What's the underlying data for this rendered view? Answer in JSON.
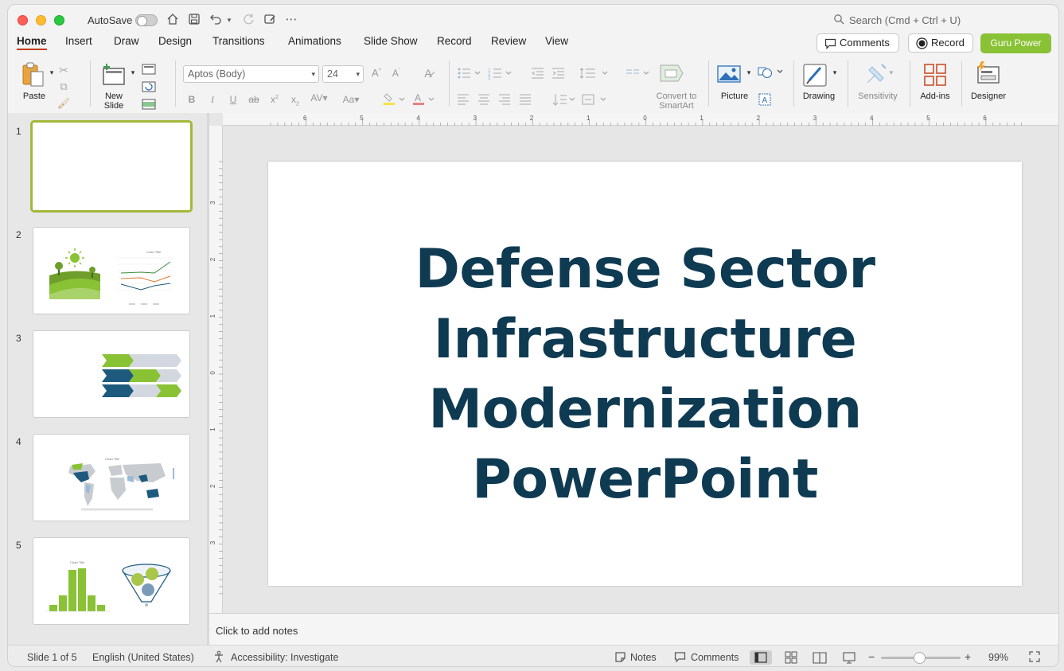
{
  "titlebar": {
    "autosave_label": "AutoSave",
    "search_placeholder": "Search (Cmd + Ctrl + U)"
  },
  "tabs": [
    {
      "label": "Home",
      "active": true
    },
    {
      "label": "Insert"
    },
    {
      "label": "Draw"
    },
    {
      "label": "Design"
    },
    {
      "label": "Transitions"
    },
    {
      "label": "Animations"
    },
    {
      "label": "Slide Show"
    },
    {
      "label": "Record"
    },
    {
      "label": "Review"
    },
    {
      "label": "View"
    }
  ],
  "header_buttons": {
    "comments": "Comments",
    "record": "Record",
    "guru": "Guru Power"
  },
  "ribbon": {
    "paste": "Paste",
    "new_slide_line1": "New",
    "new_slide_line2": "Slide",
    "font_name": "Aptos (Body)",
    "font_size": "24",
    "convert_line1": "Convert to",
    "convert_line2": "SmartArt",
    "picture": "Picture",
    "drawing": "Drawing",
    "sensitivity": "Sensitivity",
    "addins": "Add-ins",
    "designer": "Designer"
  },
  "slides": [
    {
      "number": "1"
    },
    {
      "number": "2"
    },
    {
      "number": "3"
    },
    {
      "number": "4"
    },
    {
      "number": "5"
    }
  ],
  "main_slide": {
    "title_lines": [
      "Defense Sector",
      "Infrastructure",
      "Modernization",
      "PowerPoint"
    ]
  },
  "rulers": {
    "horizontal": [
      "6",
      "5",
      "4",
      "3",
      "2",
      "1",
      "0",
      "1",
      "2",
      "3",
      "4",
      "5",
      "6"
    ],
    "vertical": [
      "3",
      "2",
      "1",
      "0",
      "1",
      "2",
      "3"
    ]
  },
  "notes_placeholder": "Click to add notes",
  "statusbar": {
    "slide_count": "Slide 1 of 5",
    "language": "English (United States)",
    "accessibility": "Accessibility: Investigate",
    "notes": "Notes",
    "comments": "Comments",
    "zoom": "99%"
  },
  "colors": {
    "accent_green": "#89c234",
    "title_navy": "#0e3a52",
    "active_tab_underline": "#c43e1c",
    "thumb_navy": "#1e5a7e"
  }
}
